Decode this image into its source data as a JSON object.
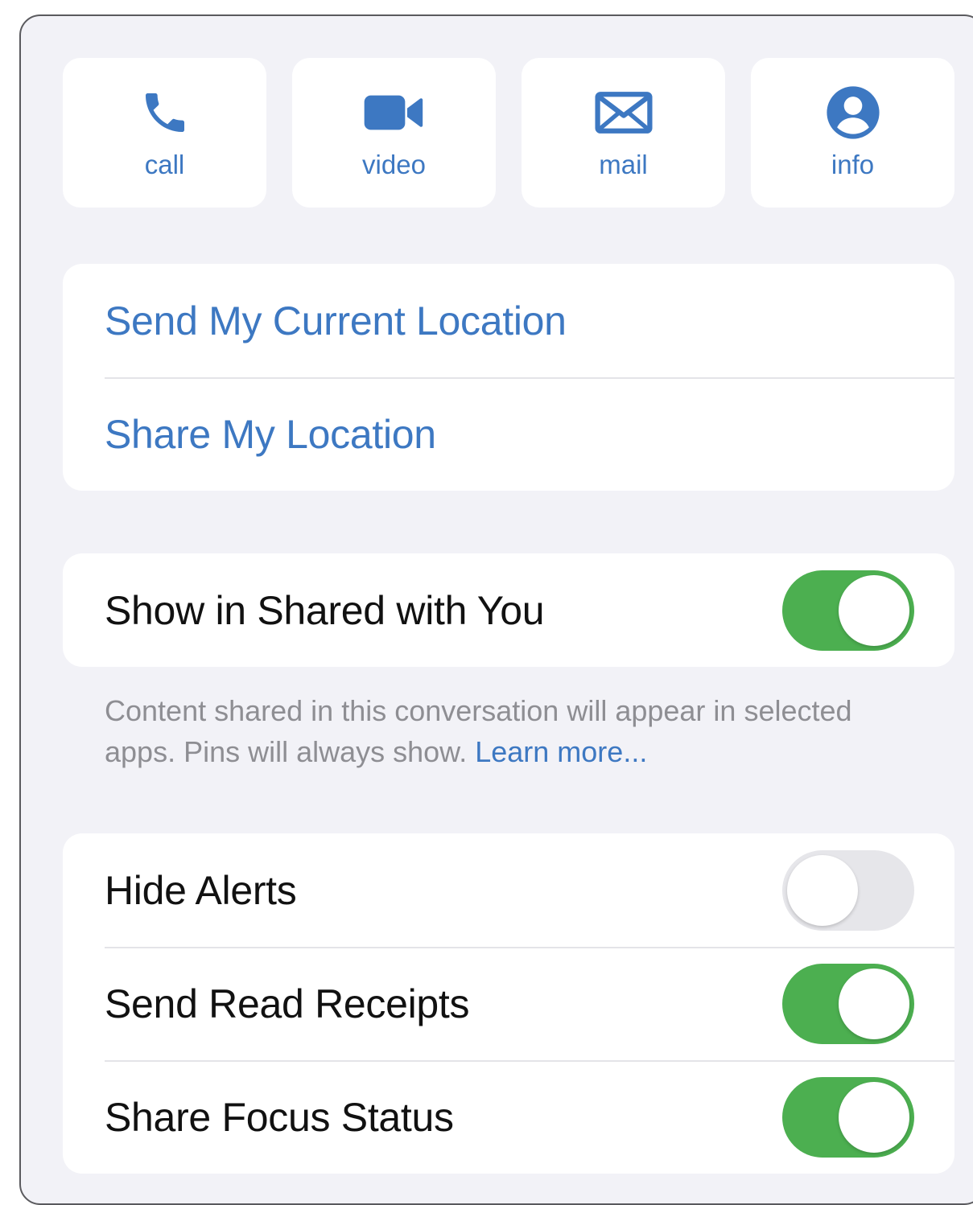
{
  "actions": [
    {
      "label": "call",
      "icon": "phone-icon"
    },
    {
      "label": "video",
      "icon": "video-camera-icon"
    },
    {
      "label": "mail",
      "icon": "envelope-icon"
    },
    {
      "label": "info",
      "icon": "person-circle-icon"
    }
  ],
  "location": {
    "send_current": "Send My Current Location",
    "share": "Share My Location"
  },
  "shared_with_you": {
    "label": "Show in Shared with You",
    "enabled": true,
    "footnote": "Content shared in this conversation will appear in selected apps. Pins will always show.",
    "learn_more": "Learn more..."
  },
  "settings": [
    {
      "label": "Hide Alerts",
      "enabled": false
    },
    {
      "label": "Send Read Receipts",
      "enabled": true
    },
    {
      "label": "Share Focus Status",
      "enabled": true
    }
  ],
  "colors": {
    "accent": "#3d78c2",
    "toggle_on": "#4caf50",
    "toggle_off": "#e6e6ea",
    "background": "#f2f2f7"
  }
}
